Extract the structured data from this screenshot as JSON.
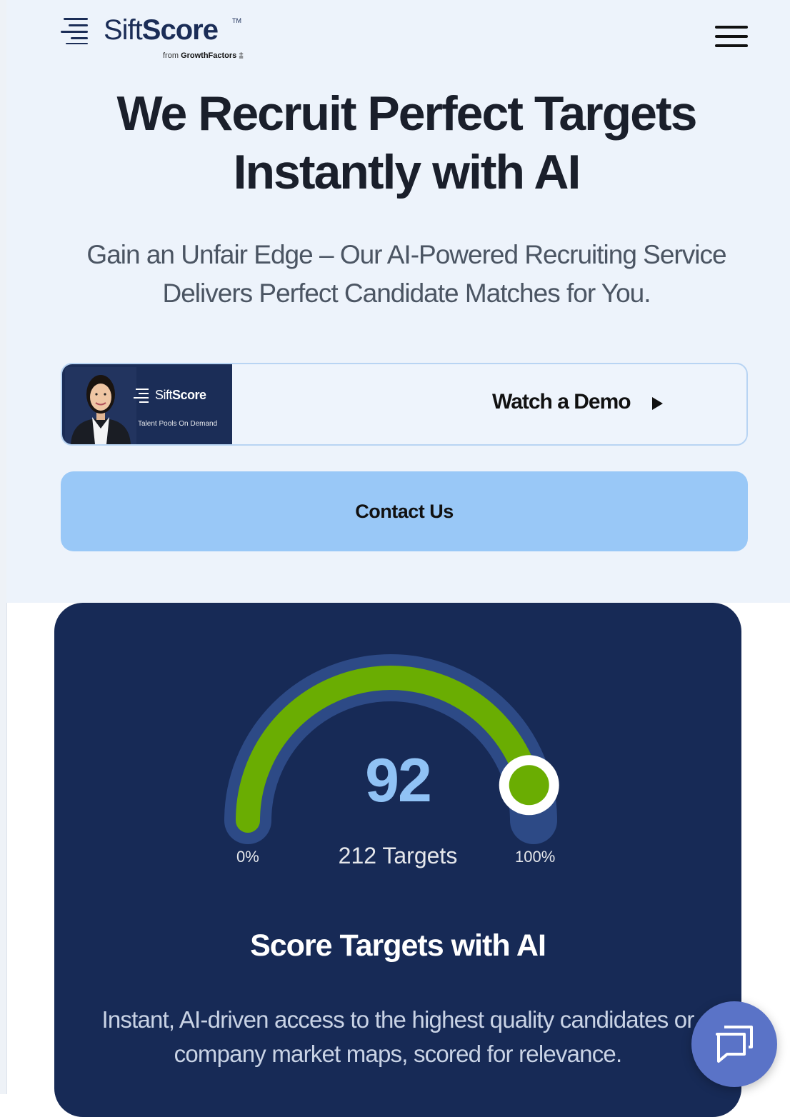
{
  "brand": {
    "name_light": "Sift",
    "name_bold": "Score",
    "trademark": "TM",
    "from_prefix": "from",
    "from_brand": "GrowthFactors",
    "logo_icon": "stacked-lines-logo-icon"
  },
  "header": {
    "menu_icon": "hamburger-menu-icon"
  },
  "hero": {
    "headline_line1": "We Recruit Perfect Targets",
    "headline_line2": "Instantly with AI",
    "subheadline": "Gain an Unfair Edge – Our AI-Powered Recruiting Service Delivers Perfect Candidate Matches for You."
  },
  "demo": {
    "thumb_brand_light": "Sift",
    "thumb_brand_bold": "Score",
    "thumb_tagline": "Talent Pools On Demand",
    "label": "Watch a Demo",
    "icon": "play-icon"
  },
  "contact": {
    "label": "Contact Us"
  },
  "score_card": {
    "score": "92",
    "min_label": "0%",
    "max_label": "100%",
    "targets_label": "212 Targets",
    "gauge_fill_fraction": 0.92,
    "title": "Score Targets with AI",
    "description": "Instant, AI-driven access to the highest quality candidates or company market maps, scored for relevance."
  },
  "chat": {
    "icon": "chat-bubbles-icon"
  },
  "colors": {
    "hero_bg": "#edf3fb",
    "brand_navy": "#1b2d57",
    "card_bg": "#172a56",
    "gauge_track": "#2d4a86",
    "gauge_fill": "#6aad02",
    "contact_bg": "#99c8f7",
    "chat_bg": "#5a73c7"
  }
}
